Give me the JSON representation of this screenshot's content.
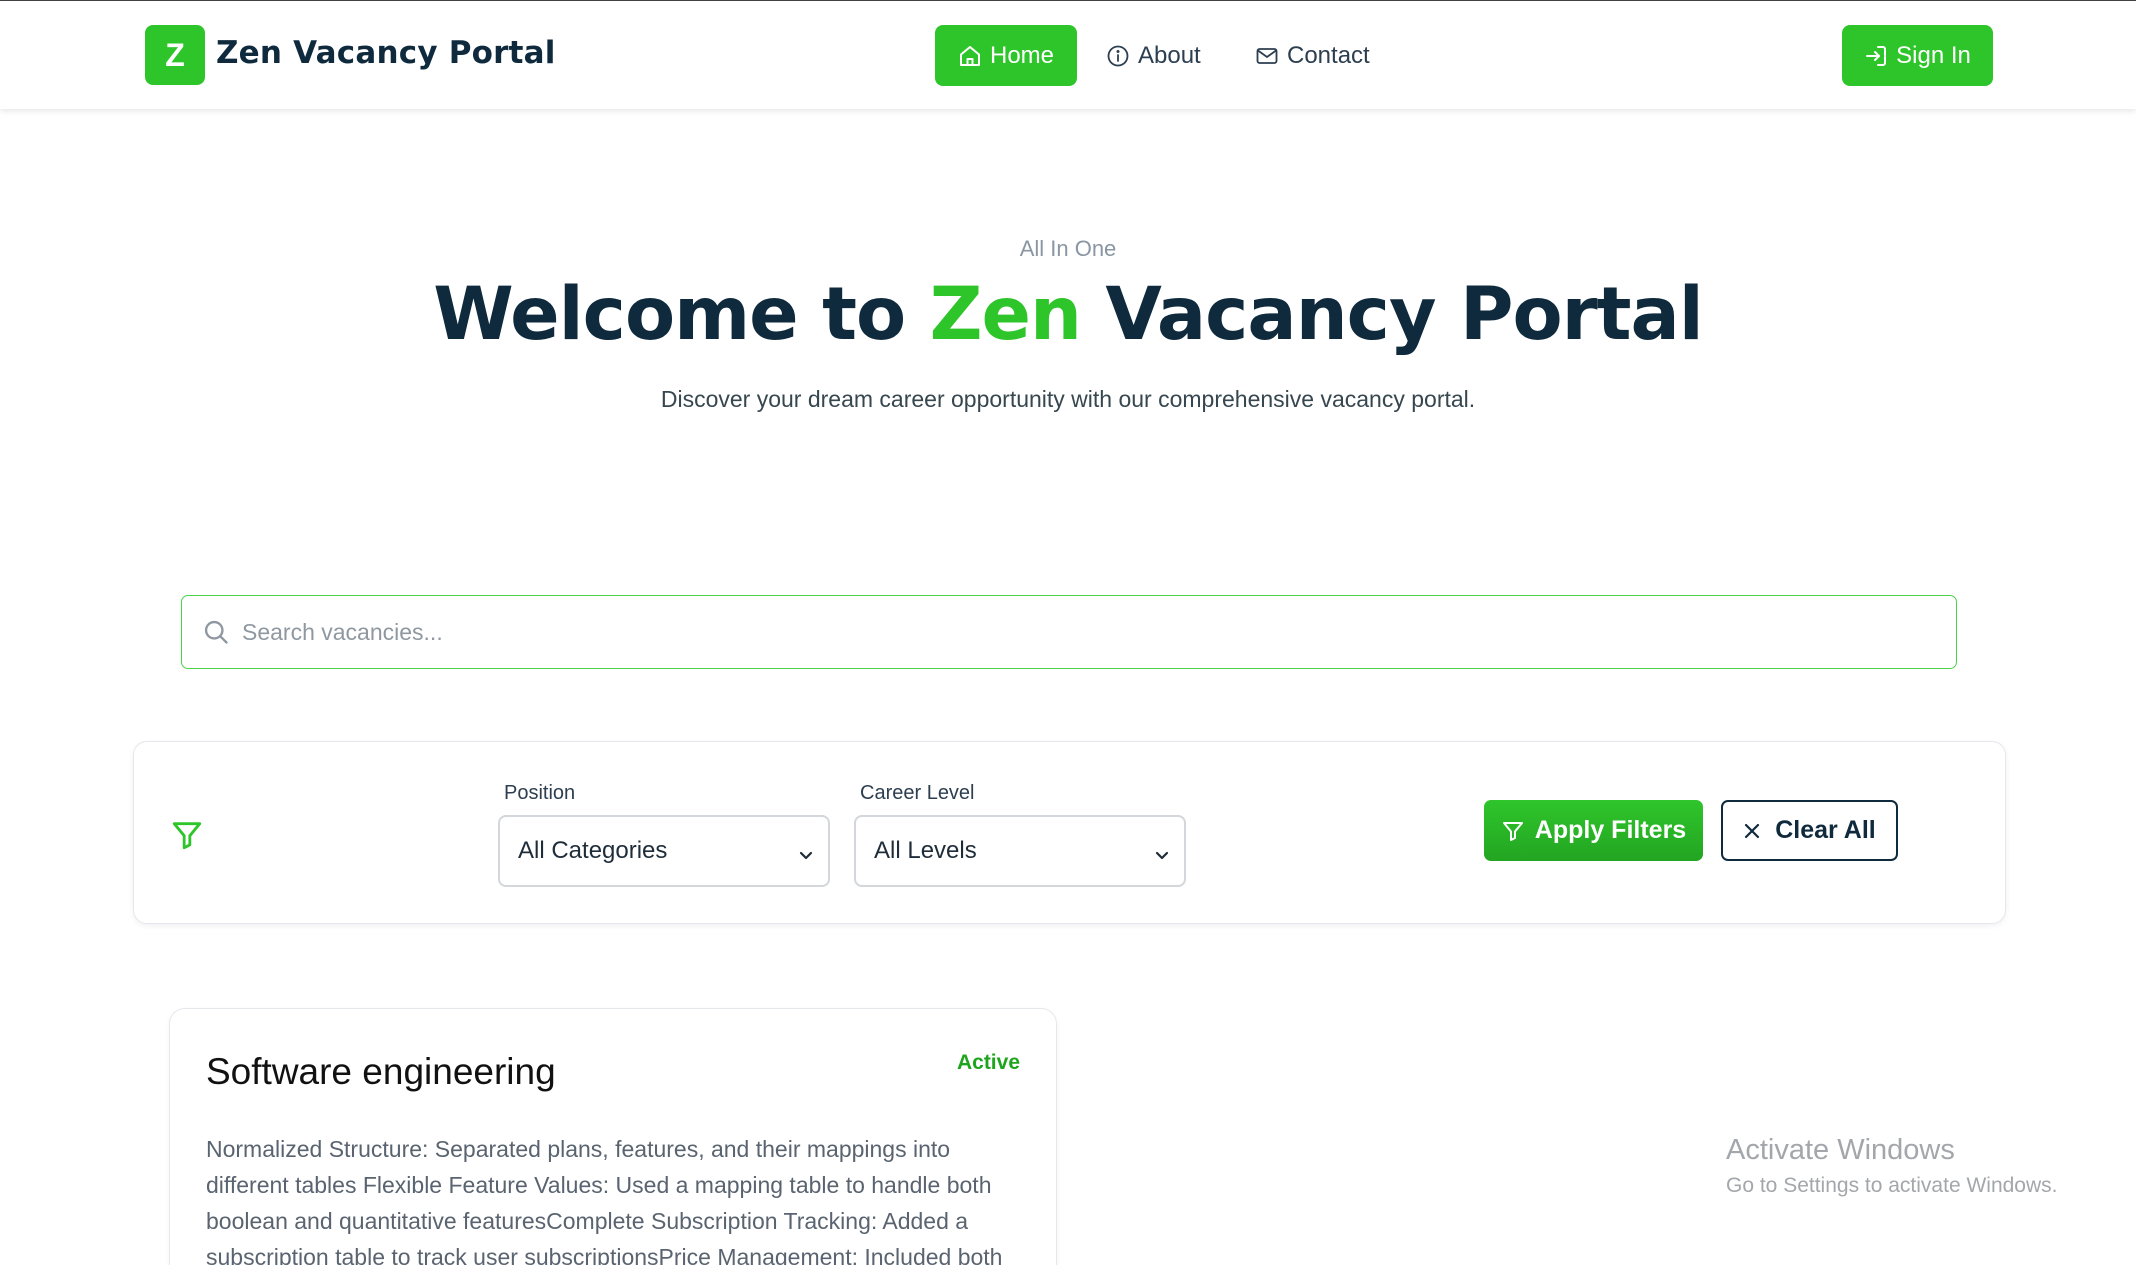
{
  "header": {
    "logo_letter": "Z",
    "brand": "Zen Vacancy Portal",
    "nav": {
      "home": "Home",
      "about": "About",
      "contact": "Contact"
    },
    "sign_in": "Sign In"
  },
  "hero": {
    "eyebrow": "All In One",
    "title_prefix": "Welcome to ",
    "title_accent": "Zen",
    "title_suffix": " Vacancy Portal",
    "subtitle": "Discover your dream career opportunity with our comprehensive vacancy portal."
  },
  "search": {
    "placeholder": "Search vacancies...",
    "value": ""
  },
  "filters": {
    "position_label": "Position",
    "position_value": "All Categories",
    "career_label": "Career Level",
    "career_value": "All Levels",
    "apply_label": "Apply Filters",
    "clear_label": "Clear All"
  },
  "jobs": [
    {
      "title": "Software engineering",
      "status": "Active",
      "description": "Normalized Structure: Separated plans, features, and their mappings into different tables Flexible Feature Values: Used a mapping table to handle both boolean and quantitative featuresComplete Subscription Tracking: Added a subscription table to track user subscriptionsPrice Management: Included both"
    }
  ],
  "watermark": {
    "title": "Activate Windows",
    "subtitle": "Go to Settings to activate Windows."
  },
  "colors": {
    "accent": "#2ec52a",
    "navy": "#0f2a3d",
    "status_active": "#1fa51d"
  },
  "icons": [
    "home-icon",
    "info-icon",
    "mail-icon",
    "sign-in-icon",
    "search-icon",
    "filter-icon",
    "chevron-down-icon",
    "close-icon"
  ]
}
